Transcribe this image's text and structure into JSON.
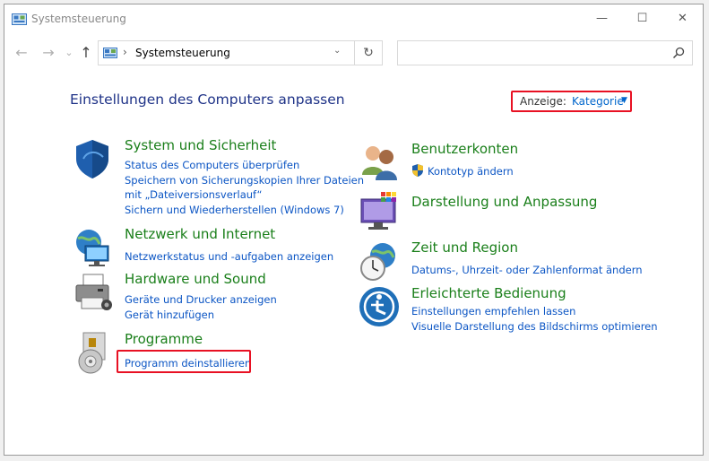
{
  "window": {
    "title": "Systemsteuerung",
    "controls": {
      "minimize": "—",
      "maximize": "☐",
      "close": "✕"
    }
  },
  "nav": {
    "back_glyph": "←",
    "forward_glyph": "→",
    "recent_glyph": "⌄",
    "up_glyph": "↑",
    "separator": "›",
    "breadcrumb": "Systemsteuerung",
    "dropdown_glyph": "⌄",
    "refresh_glyph": "↻",
    "search_placeholder": ""
  },
  "main": {
    "heading": "Einstellungen des Computers anpassen",
    "view_by": {
      "label": "Anzeige:",
      "value": "Kategorie",
      "caret": "▼"
    }
  },
  "categories_left": [
    {
      "title": "System und Sicherheit",
      "icon": "shield-icon",
      "links": [
        "Status des Computers überprüfen",
        "Speichern von Sicherungskopien Ihrer Dateien",
        "mit „Dateiversionsverlauf“",
        "Sichern und Wiederherstellen (Windows 7)"
      ]
    },
    {
      "title": "Netzwerk und Internet",
      "icon": "network-globe-icon",
      "links": [
        "Netzwerkstatus und -aufgaben anzeigen"
      ]
    },
    {
      "title": "Hardware und Sound",
      "icon": "printer-icon",
      "links": [
        "Geräte und Drucker anzeigen",
        "Gerät hinzufügen"
      ]
    },
    {
      "title": "Programme",
      "icon": "programs-disc-icon",
      "links": [
        "Programm deinstallieren"
      ]
    }
  ],
  "categories_right": [
    {
      "title": "Benutzerkonten",
      "icon": "users-icon",
      "links": [
        "Kontotyp ändern"
      ]
    },
    {
      "title": "Darstellung und Anpassung",
      "icon": "monitor-palette-icon",
      "links": []
    },
    {
      "title": "Zeit und Region",
      "icon": "clock-globe-icon",
      "links": [
        "Datums-, Uhrzeit- oder Zahlenformat ändern"
      ]
    },
    {
      "title": "Erleichterte Bedienung",
      "icon": "accessibility-icon",
      "links": [
        "Einstellungen empfehlen lassen",
        "Visuelle Darstellung des Bildschirms optimieren"
      ]
    }
  ],
  "colors": {
    "heading": "#1e3287",
    "category_title": "#1a7f1a",
    "link": "#0b55c4",
    "highlight": "#e81123"
  }
}
